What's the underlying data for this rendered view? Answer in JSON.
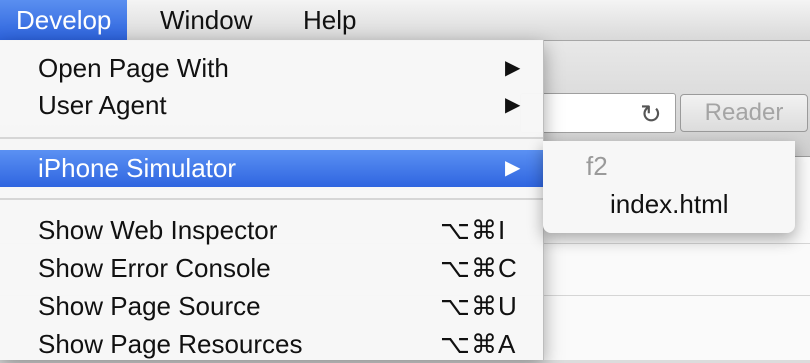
{
  "menubar": {
    "items": [
      {
        "label": "Develop"
      },
      {
        "label": "Window"
      },
      {
        "label": "Help"
      }
    ]
  },
  "browser": {
    "reader_button": "Reader"
  },
  "develop_menu": {
    "items": [
      {
        "label": "Open Page With",
        "submenu_arrow": "▶"
      },
      {
        "label": "User Agent",
        "submenu_arrow": "▶"
      },
      {
        "label": "iPhone Simulator",
        "submenu_arrow": "▶"
      },
      {
        "label": "Show Web Inspector",
        "shortcut": "⌥⌘I"
      },
      {
        "label": "Show Error Console",
        "shortcut": "⌥⌘C"
      },
      {
        "label": "Show Page Source",
        "shortcut": "⌥⌘U"
      },
      {
        "label": "Show Page Resources",
        "shortcut": "⌥⌘A"
      }
    ]
  },
  "iphone_submenu": {
    "header": "f2",
    "items": [
      {
        "label": "index.html"
      }
    ]
  },
  "colors": {
    "highlight": "#3b73e6",
    "menu_bg": "#f7f7f7"
  }
}
